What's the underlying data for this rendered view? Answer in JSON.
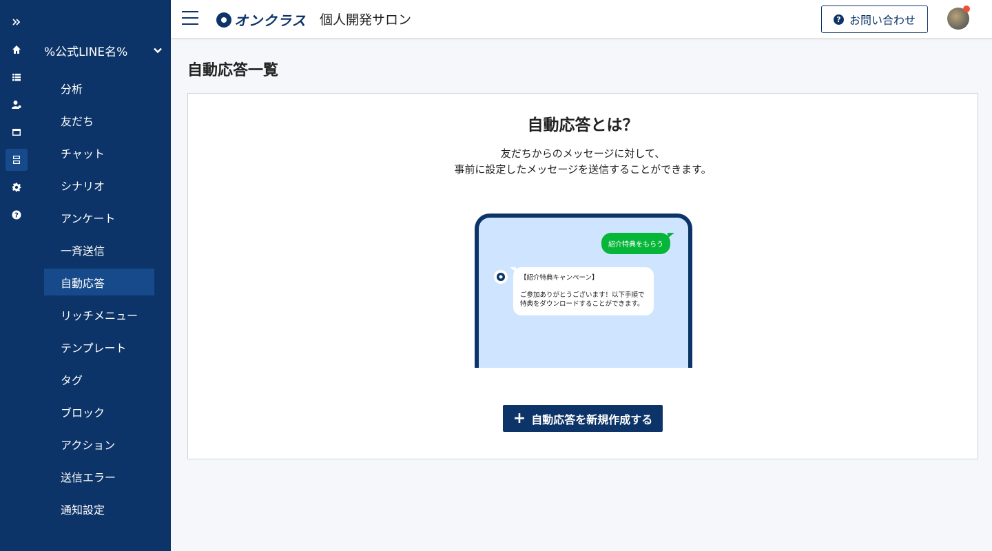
{
  "sidebar": {
    "account_name": "%公式LINE名%",
    "menu": [
      {
        "label": "分析"
      },
      {
        "label": "友だち"
      },
      {
        "label": "チャット"
      },
      {
        "label": "シナリオ"
      },
      {
        "label": "アンケート"
      },
      {
        "label": "一斉送信"
      },
      {
        "label": "自動応答",
        "active": true
      },
      {
        "label": "リッチメニュー"
      },
      {
        "label": "テンプレート"
      },
      {
        "label": "タグ"
      },
      {
        "label": "ブロック"
      },
      {
        "label": "アクション"
      },
      {
        "label": "送信エラー"
      },
      {
        "label": "通知設定"
      }
    ],
    "rail_icons": [
      "expand-icon",
      "home-icon",
      "list-icon",
      "user-settings-icon",
      "calendar-icon",
      "database-icon",
      "gear-icon",
      "help-icon"
    ]
  },
  "header": {
    "logo_text": "オンクラス",
    "site_title": "個人開発サロン",
    "contact_label": "お問い合わせ"
  },
  "main": {
    "page_title": "自動応答一覧",
    "card": {
      "title": "自動応答とは？",
      "desc_line1": "友だちからのメッセージに対して、",
      "desc_line2": "事前に設定したメッセージを送信することができます。",
      "illustration": {
        "user_message": "紹介特典をもらう",
        "bot_line1": "【紹介特典キャンペーン】",
        "bot_line2": "ご参加ありがとうございます！以下手順で",
        "bot_line3": "特典をダウンロードすることができます。"
      },
      "create_label": "自動応答を新規作成する"
    }
  },
  "colors": {
    "sidebar_bg": "#0d3468",
    "active_bg": "#164a8a",
    "line_green": "#06b639",
    "phone_bg": "#cfe4ff",
    "notification": "#f04e37"
  }
}
